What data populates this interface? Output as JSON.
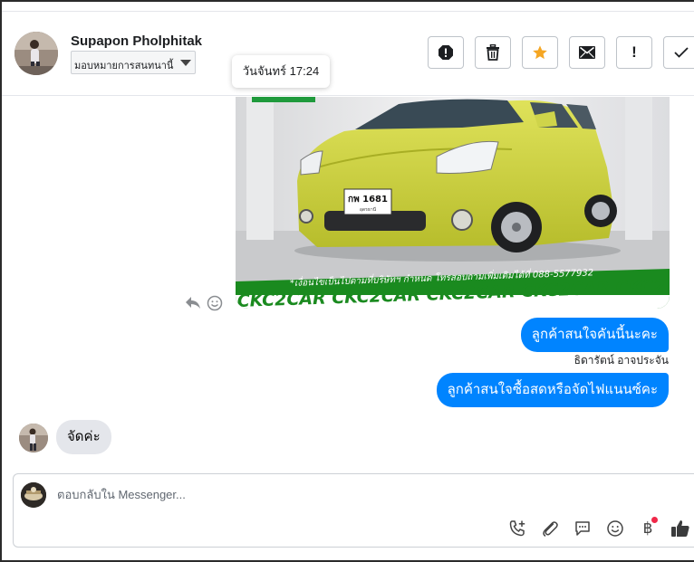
{
  "header": {
    "contact_name": "Supapon Pholphitak",
    "assign_label": "มอบหมายการสนทนานี้",
    "actions": [
      {
        "name": "spam-button",
        "icon": "alert-octagon-icon"
      },
      {
        "name": "delete-button",
        "icon": "trash-icon"
      },
      {
        "name": "star-button",
        "icon": "star-icon",
        "active_color": "#f5a623"
      },
      {
        "name": "mark-unread-button",
        "icon": "envelope-icon"
      },
      {
        "name": "follow-up-button",
        "icon": "exclamation-icon",
        "glyph": "!"
      },
      {
        "name": "done-button",
        "icon": "checkmark-icon"
      }
    ]
  },
  "tooltip": {
    "text": "วันจันทร์ 17:24"
  },
  "image_message": {
    "banner_notice": "*เงื่อนไขเป็นไปตามที่บริษัทฯ กำหนด โทรสอบถามเพิ่มเติมได้ที่ 088-5577932",
    "banner_brand": "CKC2CAR CKC2CAR CKC2CAR CKC2CAR CKC2",
    "plate_number": "กพ 1681",
    "plate_province": "อุดรธานี"
  },
  "messages": {
    "outgoing_1": "ลูกค้าสนใจคันนี้นะคะ",
    "sender_name": "ธิดารัตน์ อาจประจัน",
    "outgoing_2": "ลูกค้าสนใจซื้อสดหรือจัดไฟแนนซ์คะ",
    "incoming_1": "จัดค่ะ"
  },
  "composer": {
    "placeholder": "ตอบกลับใน Messenger...",
    "value": "",
    "tools": [
      "call-add-icon",
      "paperclip-icon",
      "chat-bubble-icon",
      "emoji-icon",
      "baht-icon",
      "thumbs-up-icon"
    ],
    "baht_symbol": "฿",
    "notification_color": "#f02849"
  },
  "colors": {
    "accent": "#0084ff",
    "incoming_bubble": "#e4e6eb",
    "banner_green": "#1a8a1f",
    "car_color": "#c9cf3a"
  }
}
